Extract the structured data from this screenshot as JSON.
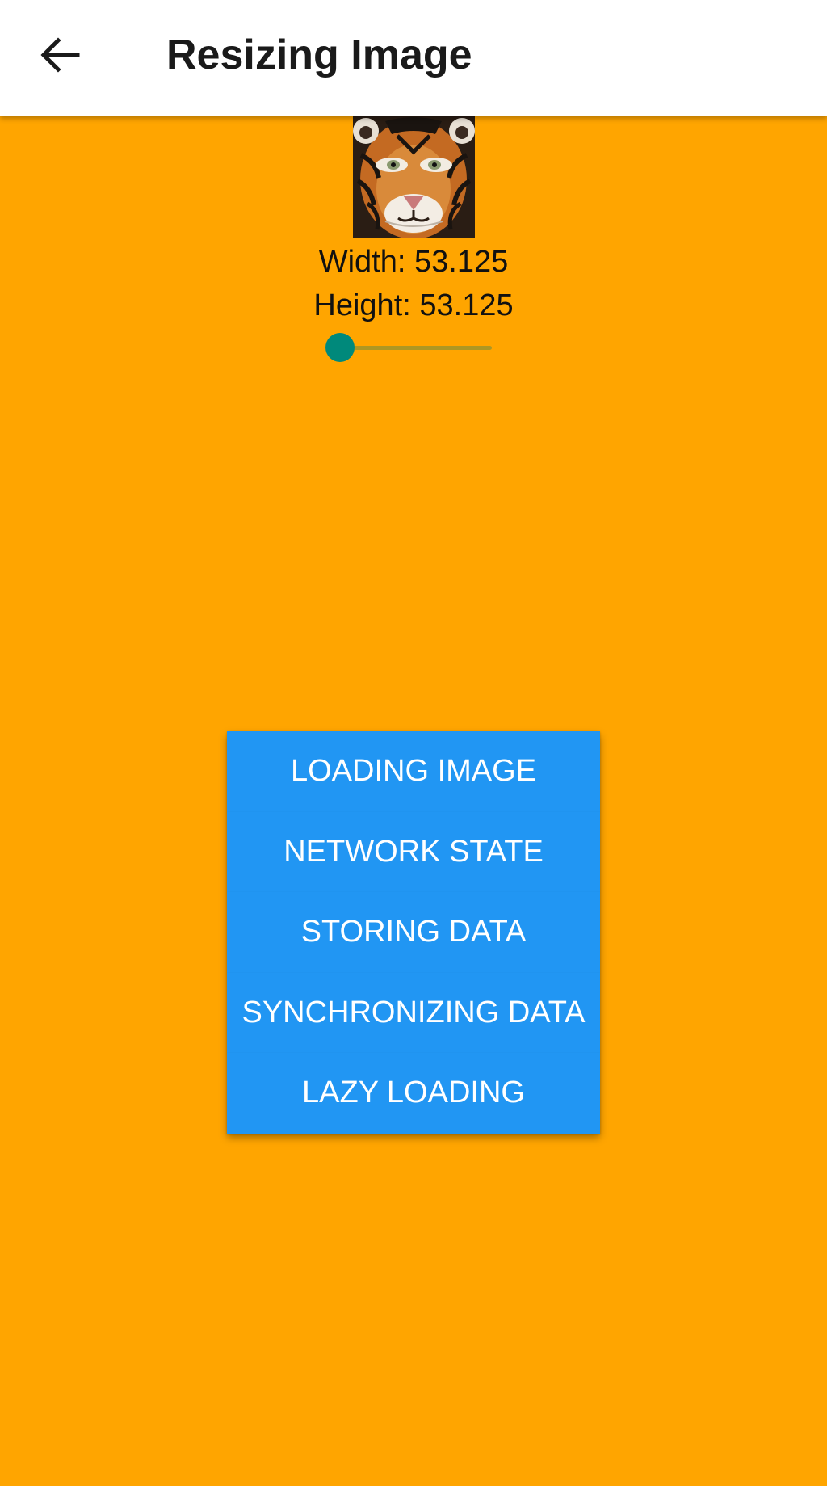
{
  "app_bar": {
    "title": "Resizing Image",
    "back_icon": "arrow-left-icon"
  },
  "image": {
    "subject": "tiger"
  },
  "size_readout": {
    "width": "Width: 53.125",
    "height": "Height: 53.125"
  },
  "slider": {
    "value_fraction": 0
  },
  "buttons": [
    {
      "label": "LOADING IMAGE"
    },
    {
      "label": "NETWORK STATE"
    },
    {
      "label": "STORING DATA"
    },
    {
      "label": "SYNCHRONIZING DATA"
    },
    {
      "label": "LAZY LOADING"
    }
  ],
  "colors": {
    "background": "#FFA500",
    "app_bar": "#FFFFFF",
    "button": "#2196F3",
    "button_text": "#FFFFFF",
    "slider_thumb": "#00897B"
  }
}
